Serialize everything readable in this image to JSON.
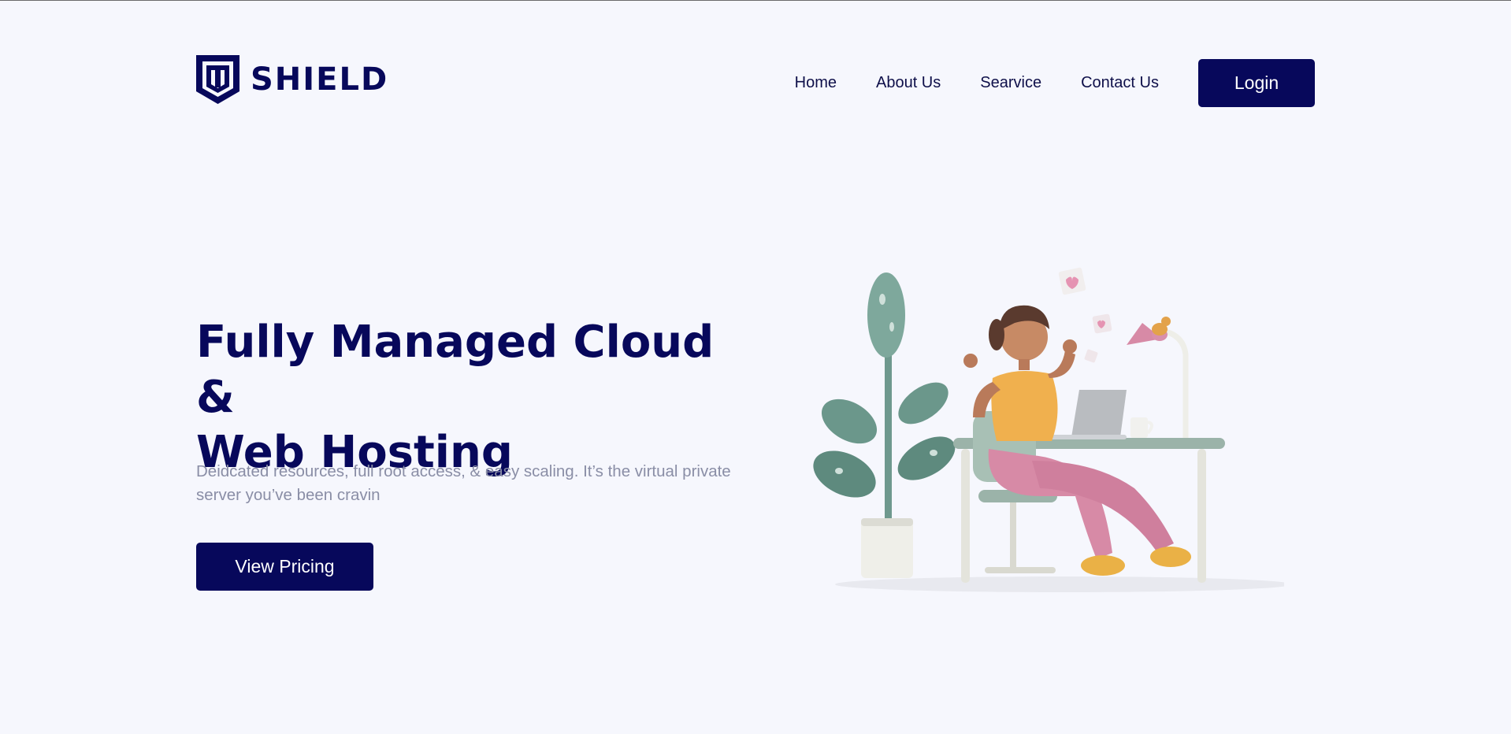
{
  "brand": {
    "name": "SHIELD",
    "logo_icon": "shield-logo-icon",
    "color": "#07085b"
  },
  "nav": {
    "items": [
      {
        "label": "Home"
      },
      {
        "label": "About Us"
      },
      {
        "label": "Searvice"
      },
      {
        "label": "Contact Us"
      }
    ],
    "login_label": "Login"
  },
  "hero": {
    "title_line1": "Fully Managed Cloud &",
    "title_line2": "Web Hosting",
    "description": "Deidcated resources, full root access, & easy scaling. It’s the virtual private server you’ve been cravin",
    "cta_label": "View Pricing",
    "illustration_icon": "woman-at-desk-illustration"
  },
  "colors": {
    "background": "#f6f7fd",
    "primary": "#07085b",
    "muted_text": "#8a8ea6"
  }
}
